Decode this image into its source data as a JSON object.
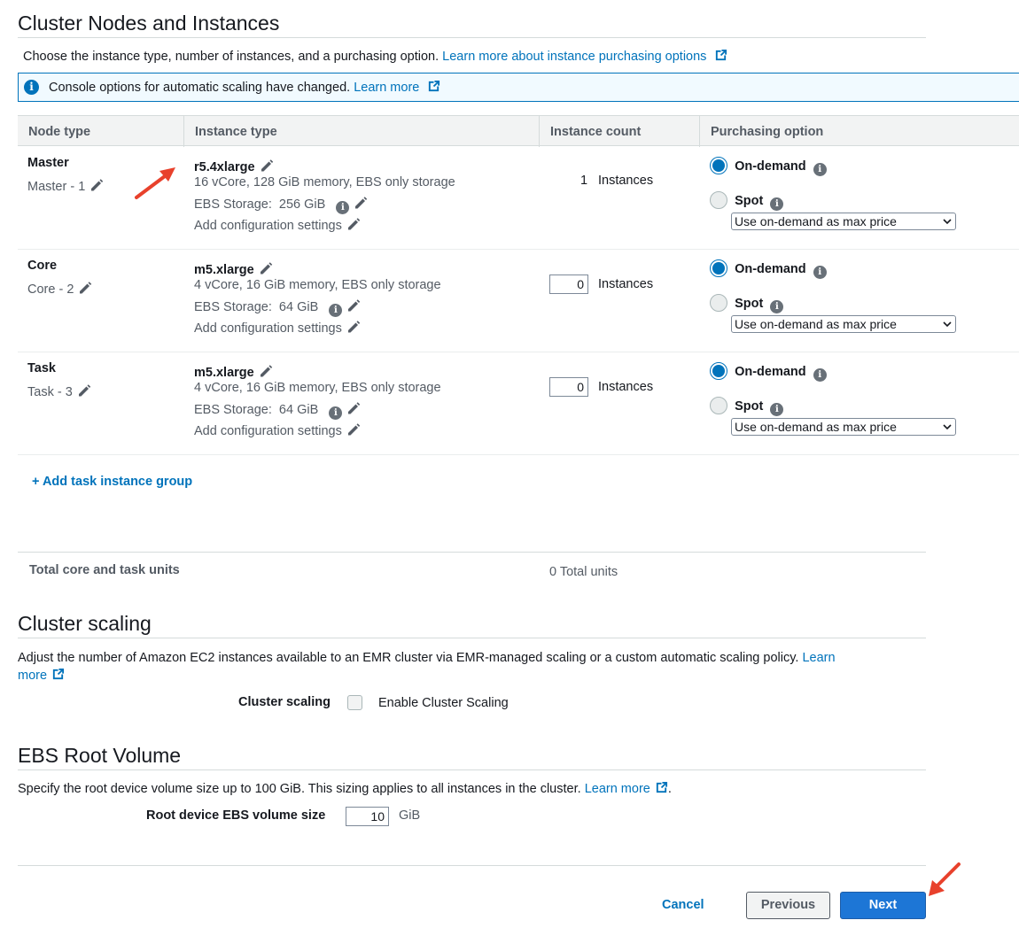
{
  "nodes_section": {
    "title": "Cluster Nodes and Instances",
    "description": "Choose the instance type, number of instances, and a purchasing option.",
    "learn_more_link": "Learn more about instance purchasing options",
    "banner_text": "Console options for automatic scaling have changed.",
    "banner_link": "Learn more",
    "columns": [
      "Node type",
      "Instance type",
      "Instance count",
      "Purchasing option"
    ],
    "rows": [
      {
        "node_type": "Master",
        "node_name": "Master - 1",
        "instance_type": "r5.4xlarge",
        "specs": "16 vCore, 128 GiB memory, EBS only storage",
        "ebs_label": "EBS Storage:",
        "ebs_value": "256 GiB",
        "config_link": "Add configuration settings",
        "count": "1",
        "count_suffix": "Instances",
        "on_demand": "On-demand",
        "spot": "Spot",
        "price_option": "Use on-demand as max price"
      },
      {
        "node_type": "Core",
        "node_name": "Core - 2",
        "instance_type": "m5.xlarge",
        "specs": "4 vCore, 16 GiB memory, EBS only storage",
        "ebs_label": "EBS Storage:",
        "ebs_value": "64 GiB",
        "config_link": "Add configuration settings",
        "count": "0",
        "count_suffix": "Instances",
        "on_demand": "On-demand",
        "spot": "Spot",
        "price_option": "Use on-demand as max price"
      },
      {
        "node_type": "Task",
        "node_name": "Task - 3",
        "instance_type": "m5.xlarge",
        "specs": "4 vCore, 16 GiB memory, EBS only storage",
        "ebs_label": "EBS Storage:",
        "ebs_value": "64 GiB",
        "config_link": "Add configuration settings",
        "count": "0",
        "count_suffix": "Instances",
        "on_demand": "On-demand",
        "spot": "Spot",
        "price_option": "Use on-demand as max price"
      }
    ],
    "add_task_group": "+ Add task instance group",
    "total_label": "Total core and task units",
    "total_value": "0 Total units"
  },
  "scaling_section": {
    "title": "Cluster scaling",
    "description": "Adjust the number of Amazon EC2 instances available to an EMR cluster via EMR-managed scaling or a custom automatic scaling policy.",
    "learn_link_1": "Learn",
    "learn_link_2": "more",
    "field_label": "Cluster scaling",
    "checkbox_label": "Enable Cluster Scaling"
  },
  "ebs_section": {
    "title": "EBS Root Volume",
    "description": "Specify the root device volume size up to 100 GiB. This sizing applies to all instances in the cluster.",
    "learn_link": "Learn more",
    "trailing": ".",
    "field_label": "Root device EBS volume size",
    "value": "10",
    "unit": "GiB"
  },
  "footer": {
    "cancel": "Cancel",
    "previous": "Previous",
    "next": "Next"
  },
  "colors": {
    "link": "#0073bb",
    "primary_button": "#1d76d6",
    "annotation_arrow": "#e8412c"
  }
}
